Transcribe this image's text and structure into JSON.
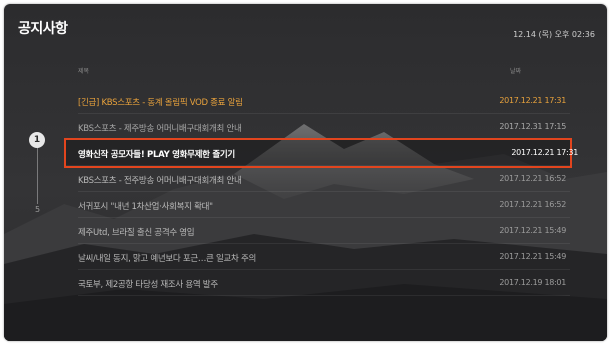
{
  "header": {
    "title": "공지사항",
    "datetime": "12.14 (목) 오후 02:36"
  },
  "columns": {
    "title": "제목",
    "date": "날짜"
  },
  "pager": {
    "current": "1",
    "total": "5"
  },
  "notices": [
    {
      "title": "[긴급] KBS스포츠 - 동계 올림픽 VOD 종료 알림",
      "date": "2017.12.21 17:31"
    },
    {
      "title": "KBS스포츠 - 제주방송 어머니배구대회개최 안내",
      "date": "2017.12.31 17:15"
    },
    {
      "title": "영화신작 공모자들! PLAY 영화무제한 즐기기",
      "date": "2017.12.21 17:31"
    },
    {
      "title": "KBS스포츠 - 전주방송 어머니배구대회개최 안내",
      "date": "2017.12.21 16:52"
    },
    {
      "title": "서귀포시 \"내년 1차산업·사회복지 확대\"",
      "date": "2017.12.21 16:52"
    },
    {
      "title": "제주Utd, 브라질 출신 공격수 영입",
      "date": "2017.12.21 15:49"
    },
    {
      "title": "날씨/내일 동지, 맑고 예년보다 포근…큰 일교차 주의",
      "date": "2017.12.21 15:49"
    },
    {
      "title": "국토부, 제2공항 타당성 재조사 용역 발주",
      "date": "2017.12.19 18:01"
    }
  ],
  "colors": {
    "urgent": "#e8a23c",
    "focus_border": "#e2451e"
  }
}
